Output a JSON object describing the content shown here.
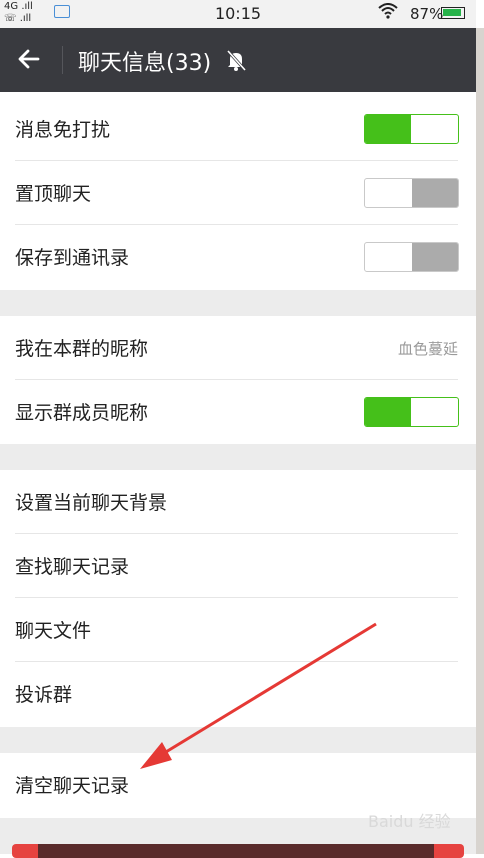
{
  "status_bar": {
    "network": "4G",
    "time": "10:15",
    "battery_text": "87%",
    "battery_level": 0.87,
    "icons": [
      "signal-icon",
      "call-icon",
      "picture-icon",
      "wifi-icon",
      "battery-icon"
    ]
  },
  "title_bar": {
    "title": "聊天信息(33)",
    "icons": [
      "back-arrow-icon",
      "mute-bell-icon"
    ]
  },
  "sections": [
    {
      "rows": [
        {
          "label": "消息免打扰",
          "toggle": true
        },
        {
          "label": "置顶聊天",
          "toggle": false
        },
        {
          "label": "保存到通讯录",
          "toggle": false
        }
      ]
    },
    {
      "rows": [
        {
          "label": "我在本群的昵称",
          "value": "血色蔓延"
        },
        {
          "label": "显示群成员昵称",
          "toggle": true
        }
      ]
    },
    {
      "rows": [
        {
          "label": "设置当前聊天背景"
        },
        {
          "label": "查找聊天记录"
        },
        {
          "label": "聊天文件"
        },
        {
          "label": "投诉群"
        }
      ]
    },
    {
      "rows": [
        {
          "label": "清空聊天记录"
        }
      ]
    }
  ],
  "watermark": "Baidu 经验",
  "colors": {
    "title_bar_bg": "#393a3f",
    "toggle_on": "#45c01a",
    "toggle_off": "#ababab",
    "annotation_arrow": "#e53935",
    "page_bg": "#ececec"
  }
}
